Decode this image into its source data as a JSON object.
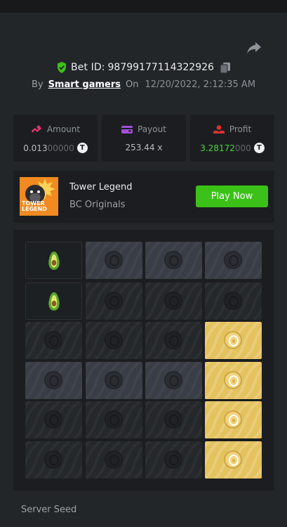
{
  "bet": {
    "label": "Bet ID:",
    "id": "98799177114322926"
  },
  "byline": {
    "by": "By",
    "user": "Smart gamers",
    "on": "On",
    "date": "12/20/2022, 2:12:35 AM"
  },
  "stats": {
    "amount": {
      "label": "Amount",
      "value_main": "0.013",
      "value_dim": "00000",
      "icon": "amount-icon",
      "token": "T"
    },
    "payout": {
      "label": "Payout",
      "value": "253.44 x",
      "icon": "wallet-icon"
    },
    "profit": {
      "label": "Profit",
      "value_main": "3.28172",
      "value_dim": "000",
      "icon": "profit-icon",
      "token": "T"
    }
  },
  "game": {
    "name": "Tower Legend",
    "provider": "BC Originals",
    "play_label": "Play Now",
    "thumb_text1": "TOWER",
    "thumb_text2": "LEGEND"
  },
  "board": {
    "rows": [
      [
        "avocado",
        "grey",
        "grey",
        "grey"
      ],
      [
        "avocado",
        "dark",
        "dark",
        "dark"
      ],
      [
        "dark",
        "dark",
        "dark",
        "gold"
      ],
      [
        "grey",
        "grey",
        "grey",
        "gold"
      ],
      [
        "dark",
        "dark",
        "dark",
        "gold"
      ],
      [
        "dark",
        "dark",
        "dark",
        "gold"
      ]
    ]
  },
  "server_seed": {
    "label": "Server Seed"
  },
  "colors": {
    "accent_green": "#3bc117",
    "gold": "#e4c25e",
    "profit_green": "#4bd43a",
    "background": "#232629",
    "panel": "#1b1d20"
  }
}
